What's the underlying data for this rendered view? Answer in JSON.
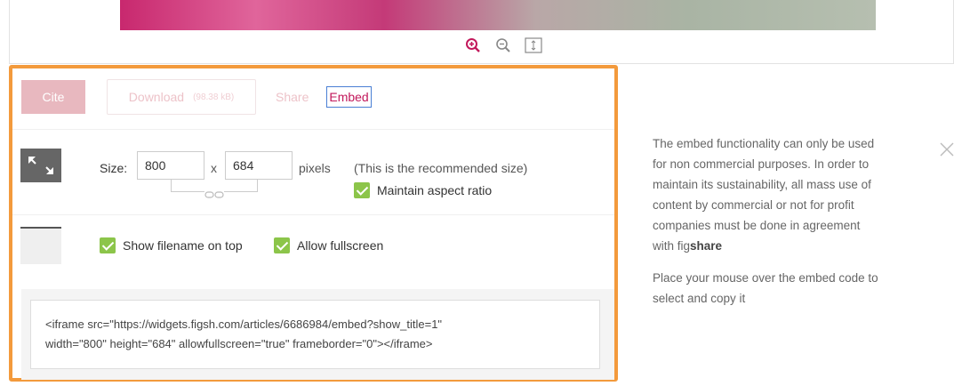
{
  "zoom_controls": {
    "zoom_in_icon": "zoom-in-icon",
    "zoom_out_icon": "zoom-out-icon",
    "fit_icon": "fit-height-icon"
  },
  "tabs": {
    "cite": "Cite",
    "download": "Download",
    "download_size": "(98.38 kB)",
    "share": "Share",
    "embed": "Embed"
  },
  "size": {
    "label": "Size:",
    "width": "800",
    "separator": "x",
    "height": "684",
    "unit": "pixels",
    "note": "(This is the recommended size)",
    "maintain_aspect": "Maintain aspect ratio"
  },
  "options": {
    "show_filename": "Show filename on top",
    "allow_fullscreen": "Allow fullscreen"
  },
  "embed_code": {
    "line1": "<iframe src=\"https://widgets.figsh.com/articles/6686984/embed?show_title=1\"",
    "line2": "width=\"800\" height=\"684\" allowfullscreen=\"true\" frameborder=\"0\"></iframe>"
  },
  "info": {
    "paragraph1_prefix": "The embed functionality can only be used for non commercial purposes. In order to maintain its sustainability, all mass use of content by commercial or not for profit companies must be done in agreement with fig",
    "paragraph1_brand": "share",
    "paragraph2": "Place your mouse over the embed code to select and copy it"
  },
  "colors": {
    "highlight": "#f39a3c",
    "check": "#8cc54a",
    "brand": "#c2185b"
  }
}
